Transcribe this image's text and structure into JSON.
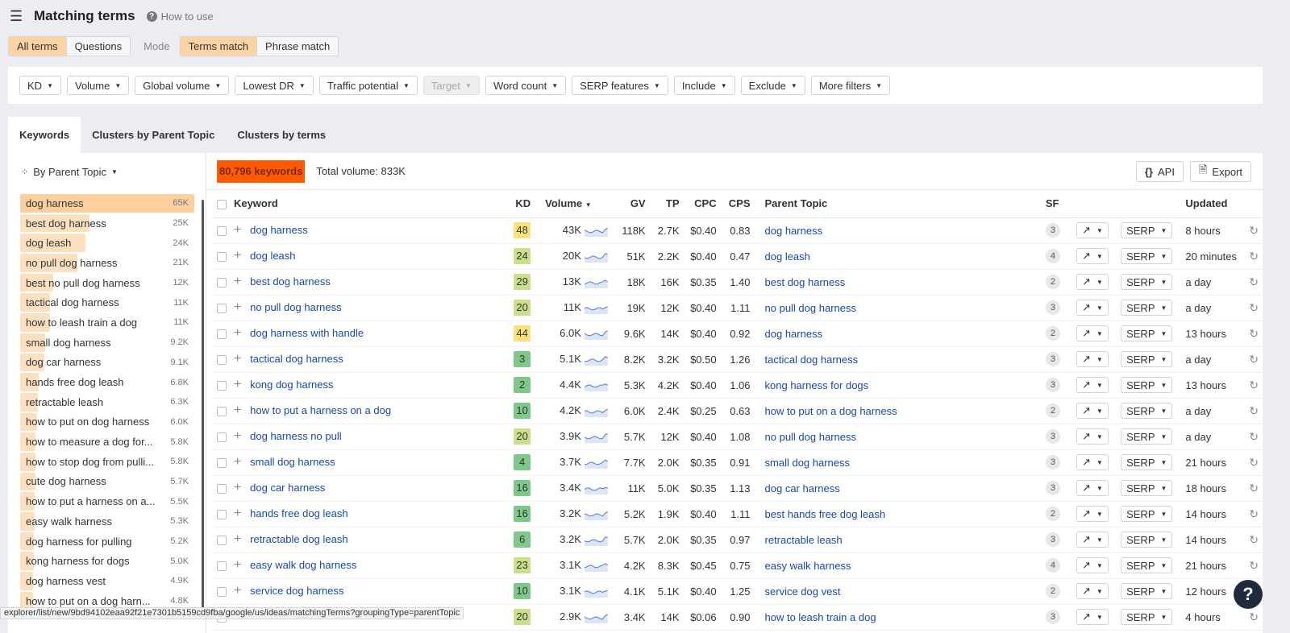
{
  "header": {
    "title": "Matching terms",
    "how_to_use": "How to use"
  },
  "mode": {
    "group1": [
      {
        "label": "All terms",
        "active": true
      },
      {
        "label": "Questions",
        "active": false
      }
    ],
    "mode_label": "Mode",
    "group2": [
      {
        "label": "Terms match",
        "active": true
      },
      {
        "label": "Phrase match",
        "active": false
      }
    ]
  },
  "filters": [
    {
      "label": "KD",
      "disabled": false
    },
    {
      "label": "Volume",
      "disabled": false
    },
    {
      "label": "Global volume",
      "disabled": false
    },
    {
      "label": "Lowest DR",
      "disabled": false
    },
    {
      "label": "Traffic potential",
      "disabled": false
    },
    {
      "label": "Target",
      "disabled": true
    },
    {
      "label": "Word count",
      "disabled": false
    },
    {
      "label": "SERP features",
      "disabled": false
    },
    {
      "label": "Include",
      "disabled": false
    },
    {
      "label": "Exclude",
      "disabled": false
    },
    {
      "label": "More filters",
      "disabled": false
    }
  ],
  "tabs": [
    {
      "label": "Keywords",
      "active": true
    },
    {
      "label": "Clusters by Parent Topic",
      "active": false
    },
    {
      "label": "Clusters by terms",
      "active": false
    }
  ],
  "sidebar": {
    "group_by": "By Parent Topic",
    "items": [
      {
        "label": "dog harness",
        "count": "65K",
        "share": 1.0
      },
      {
        "label": "best dog harness",
        "count": "25K",
        "share": 0.4
      },
      {
        "label": "dog leash",
        "count": "24K",
        "share": 0.375
      },
      {
        "label": "no pull dog harness",
        "count": "21K",
        "share": 0.33
      },
      {
        "label": "best no pull dog harness",
        "count": "12K",
        "share": 0.19
      },
      {
        "label": "tactical dog harness",
        "count": "11K",
        "share": 0.17
      },
      {
        "label": "how to leash train a dog",
        "count": "11K",
        "share": 0.17
      },
      {
        "label": "small dog harness",
        "count": "9.2K",
        "share": 0.145
      },
      {
        "label": "dog car harness",
        "count": "9.1K",
        "share": 0.14
      },
      {
        "label": "hands free dog leash",
        "count": "6.8K",
        "share": 0.105
      },
      {
        "label": "retractable leash",
        "count": "6.3K",
        "share": 0.1
      },
      {
        "label": "how to put on dog harness",
        "count": "6.0K",
        "share": 0.095
      },
      {
        "label": "how to measure a dog for...",
        "count": "5.8K",
        "share": 0.09
      },
      {
        "label": "how to stop dog from pulli...",
        "count": "5.8K",
        "share": 0.09
      },
      {
        "label": "cute dog harness",
        "count": "5.7K",
        "share": 0.088
      },
      {
        "label": "how to put a harness on a...",
        "count": "5.5K",
        "share": 0.085
      },
      {
        "label": "easy walk harness",
        "count": "5.3K",
        "share": 0.082
      },
      {
        "label": "dog harness for pulling",
        "count": "5.2K",
        "share": 0.08
      },
      {
        "label": "kong harness for dogs",
        "count": "5.0K",
        "share": 0.078
      },
      {
        "label": "dog harness vest",
        "count": "4.9K",
        "share": 0.076
      },
      {
        "label": "how to put on a dog harn...",
        "count": "4.8K",
        "share": 0.074
      }
    ]
  },
  "summary": {
    "keywords": "80,796 keywords",
    "total_volume": "Total volume: 833K"
  },
  "actions": {
    "api": "API",
    "export": "Export"
  },
  "table": {
    "headers": {
      "keyword": "Keyword",
      "kd": "KD",
      "volume": "Volume",
      "gv": "GV",
      "tp": "TP",
      "cpc": "CPC",
      "cps": "CPS",
      "parent": "Parent Topic",
      "sf": "SF",
      "updated": "Updated"
    },
    "serp_label": "SERP",
    "rows": [
      {
        "keyword": "dog harness",
        "kd": "48",
        "kd_color": "#fbe27a",
        "volume": "43K",
        "gv": "118K",
        "tp": "2.7K",
        "cpc": "$0.40",
        "cps": "0.83",
        "parent": "dog harness",
        "sf": "3",
        "updated": "8 hours"
      },
      {
        "keyword": "dog leash",
        "kd": "24",
        "kd_color": "#c8e08a",
        "volume": "20K",
        "gv": "51K",
        "tp": "2.2K",
        "cpc": "$0.40",
        "cps": "0.47",
        "parent": "dog leash",
        "sf": "4",
        "updated": "20 minutes"
      },
      {
        "keyword": "best dog harness",
        "kd": "29",
        "kd_color": "#c8e08a",
        "volume": "13K",
        "gv": "18K",
        "tp": "16K",
        "cpc": "$0.35",
        "cps": "1.40",
        "parent": "best dog harness",
        "sf": "2",
        "updated": "a day"
      },
      {
        "keyword": "no pull dog harness",
        "kd": "20",
        "kd_color": "#c8e08a",
        "volume": "11K",
        "gv": "19K",
        "tp": "12K",
        "cpc": "$0.40",
        "cps": "1.11",
        "parent": "no pull dog harness",
        "sf": "3",
        "updated": "a day"
      },
      {
        "keyword": "dog harness with handle",
        "kd": "44",
        "kd_color": "#fbe27a",
        "volume": "6.0K",
        "gv": "9.6K",
        "tp": "14K",
        "cpc": "$0.40",
        "cps": "0.92",
        "parent": "dog harness",
        "sf": "2",
        "updated": "13 hours"
      },
      {
        "keyword": "tactical dog harness",
        "kd": "3",
        "kd_color": "#7ec98a",
        "volume": "5.1K",
        "gv": "8.2K",
        "tp": "3.2K",
        "cpc": "$0.50",
        "cps": "1.26",
        "parent": "tactical dog harness",
        "sf": "3",
        "updated": "a day"
      },
      {
        "keyword": "kong dog harness",
        "kd": "2",
        "kd_color": "#7ec98a",
        "volume": "4.4K",
        "gv": "5.3K",
        "tp": "4.2K",
        "cpc": "$0.40",
        "cps": "1.06",
        "parent": "kong harness for dogs",
        "sf": "3",
        "updated": "13 hours"
      },
      {
        "keyword": "how to put a harness on a dog",
        "kd": "10",
        "kd_color": "#7ec98a",
        "volume": "4.2K",
        "gv": "6.0K",
        "tp": "2.4K",
        "cpc": "$0.25",
        "cps": "0.63",
        "parent": "how to put on a dog harness",
        "sf": "2",
        "updated": "a day"
      },
      {
        "keyword": "dog harness no pull",
        "kd": "20",
        "kd_color": "#c8e08a",
        "volume": "3.9K",
        "gv": "5.7K",
        "tp": "12K",
        "cpc": "$0.40",
        "cps": "1.08",
        "parent": "no pull dog harness",
        "sf": "3",
        "updated": "a day"
      },
      {
        "keyword": "small dog harness",
        "kd": "4",
        "kd_color": "#7ec98a",
        "volume": "3.7K",
        "gv": "7.7K",
        "tp": "2.0K",
        "cpc": "$0.35",
        "cps": "0.91",
        "parent": "small dog harness",
        "sf": "3",
        "updated": "21 hours"
      },
      {
        "keyword": "dog car harness",
        "kd": "16",
        "kd_color": "#7ec98a",
        "volume": "3.4K",
        "gv": "11K",
        "tp": "5.0K",
        "cpc": "$0.35",
        "cps": "1.13",
        "parent": "dog car harness",
        "sf": "3",
        "updated": "18 hours"
      },
      {
        "keyword": "hands free dog leash",
        "kd": "16",
        "kd_color": "#7ec98a",
        "volume": "3.2K",
        "gv": "5.2K",
        "tp": "1.9K",
        "cpc": "$0.40",
        "cps": "1.11",
        "parent": "best hands free dog leash",
        "sf": "2",
        "updated": "14 hours"
      },
      {
        "keyword": "retractable dog leash",
        "kd": "6",
        "kd_color": "#7ec98a",
        "volume": "3.2K",
        "gv": "5.7K",
        "tp": "2.0K",
        "cpc": "$0.35",
        "cps": "0.97",
        "parent": "retractable leash",
        "sf": "3",
        "updated": "14 hours"
      },
      {
        "keyword": "easy walk dog harness",
        "kd": "23",
        "kd_color": "#c8e08a",
        "volume": "3.1K",
        "gv": "4.2K",
        "tp": "8.3K",
        "cpc": "$0.45",
        "cps": "0.75",
        "parent": "easy walk harness",
        "sf": "4",
        "updated": "21 hours"
      },
      {
        "keyword": "service dog harness",
        "kd": "10",
        "kd_color": "#7ec98a",
        "volume": "3.1K",
        "gv": "4.1K",
        "tp": "5.1K",
        "cpc": "$0.40",
        "cps": "1.25",
        "parent": "service dog vest",
        "sf": "2",
        "updated": "12 hours"
      },
      {
        "keyword": "",
        "kd": "20",
        "kd_color": "#c8e08a",
        "volume": "2.9K",
        "gv": "3.4K",
        "tp": "14K",
        "cpc": "$0.06",
        "cps": "0.90",
        "parent": "how to leash train a dog",
        "sf": "3",
        "updated": "4 hours"
      }
    ]
  },
  "status_url": "explorer/list/new/9bd94102eaa92f21e7301b5159cd9fba/google/us/ideas/matchingTerms?groupingType=parentTopic",
  "help_label": "?"
}
